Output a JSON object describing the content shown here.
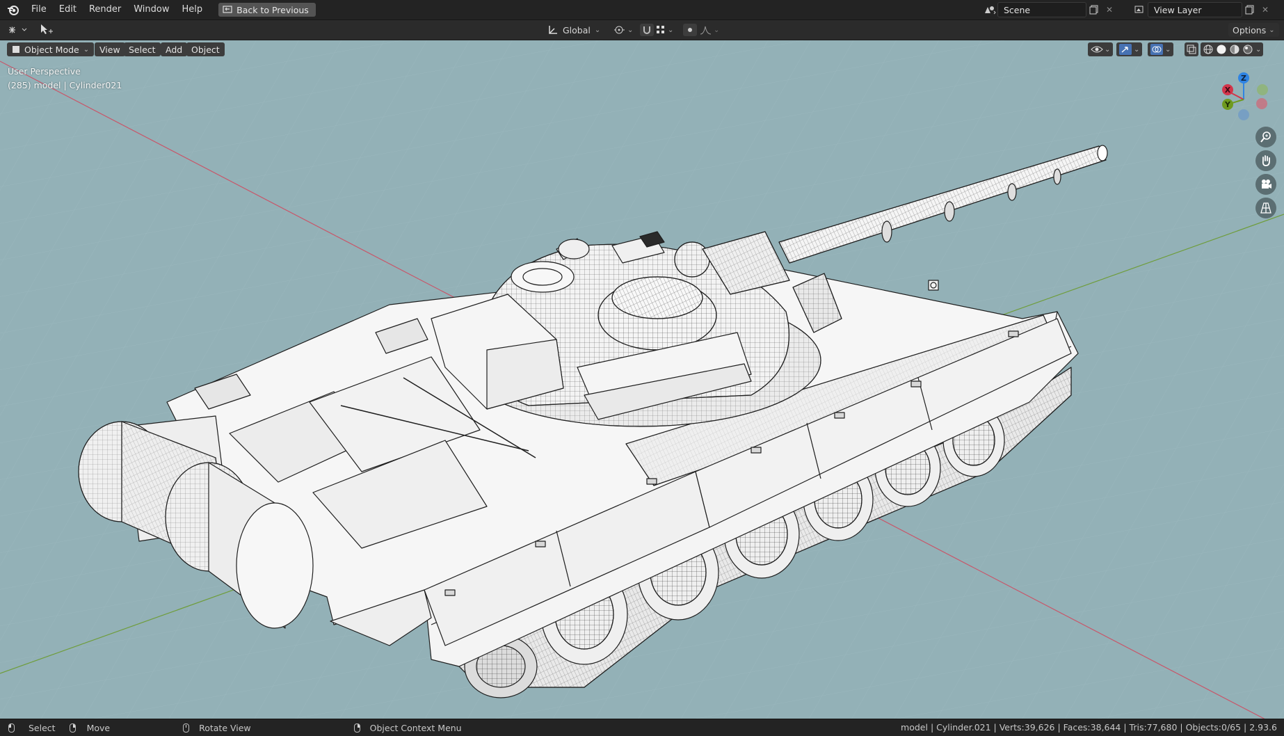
{
  "menubar": {
    "items": [
      "File",
      "Edit",
      "Render",
      "Window",
      "Help"
    ],
    "back_button": "Back to Previous",
    "scene_name": "Scene",
    "view_layer": "View Layer"
  },
  "toolbar": {
    "transform_orientation": "Global",
    "options_label": "Options"
  },
  "viewport_header": {
    "mode": "Object Mode",
    "menus": [
      "View",
      "Select",
      "Add",
      "Object"
    ]
  },
  "viewport_overlay": {
    "perspective": "User Perspective",
    "object_info": "(285) model | Cylinder021"
  },
  "gizmo": {
    "axes": {
      "x": "X",
      "y": "Y",
      "z": "Z"
    },
    "colors": {
      "x": "#d2354a",
      "y": "#6e9a1e",
      "z": "#2f84e3",
      "neg_x": "#cf6a78",
      "neg_y": "#8fb56c",
      "neg_z": "#6e99c7"
    }
  },
  "navigation_icons": [
    "zoom-icon",
    "pan-hand-icon",
    "camera-icon",
    "grid-perspective-icon"
  ],
  "statusbar": {
    "select": "Select",
    "move": "Move",
    "rotate": "Rotate View",
    "context_menu": "Object Context Menu",
    "stats": "model | Cylinder.021 | Verts:39,626 | Faces:38,644 | Tris:77,680 | Objects:0/65 | 2.93.6"
  },
  "colors": {
    "viewport_bg": "#93b1b7",
    "grid_x_axis": "#c8576a",
    "grid_y_axis": "#6f9d3b",
    "accent_active": "#4772b3"
  }
}
